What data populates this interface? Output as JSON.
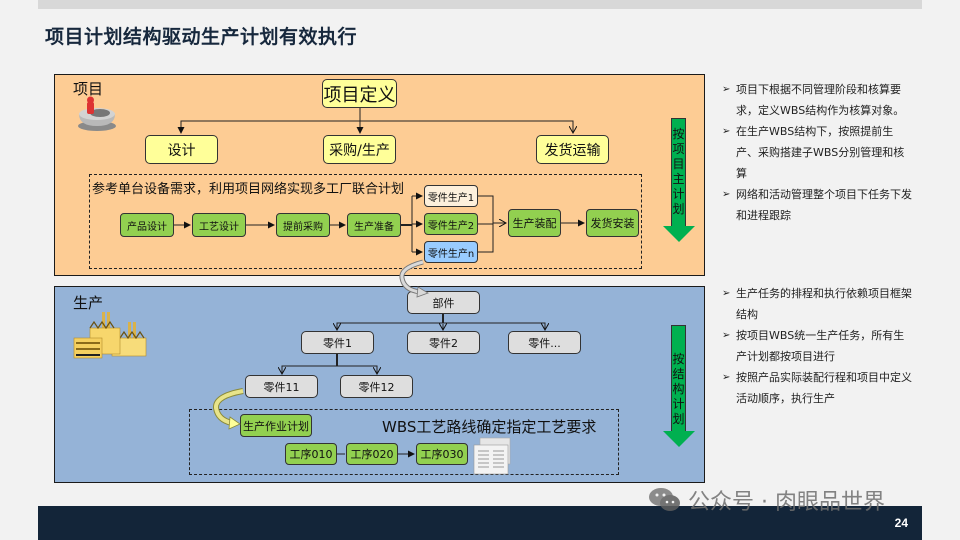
{
  "title": "项目计划结构驱动生产计划有效执行",
  "project_panel": {
    "label": "项目",
    "icon": "project-person-icon",
    "root": "项目定义",
    "branches": [
      "设计",
      "采购/生产",
      "发货运输"
    ],
    "network_title": "参考单台设备需求，利用项目网络实现多工厂联合计划",
    "network_steps": [
      "产品设计",
      "工艺设计",
      "提前采购",
      "生产准备"
    ],
    "parallel_parts": [
      "零件生产1",
      "零件生产2",
      "零件生产n"
    ],
    "assembly": "生产装配",
    "delivery": "发货安装",
    "side_arrow": [
      "按",
      "项",
      "目",
      "主",
      "计",
      "划"
    ]
  },
  "production_panel": {
    "label": "生产",
    "icon": "factory-icon",
    "root": "部件",
    "level1": [
      "零件1",
      "零件2",
      "零件..."
    ],
    "level2": [
      "零件11",
      "零件12"
    ],
    "work_plan": "生产作业计划",
    "wbs_title": "WBS工艺路线确定指定工艺要求",
    "operations": [
      "工序010",
      "工序020",
      "工序030"
    ],
    "side_arrow": [
      "按",
      "结",
      "构",
      "计",
      "划"
    ]
  },
  "bullets_top": [
    {
      "marker": "➢",
      "text": "项目下根据不同管理阶段和核算要求，定义WBS结构作为核算对象。"
    },
    {
      "marker": "➢",
      "text": "在生产WBS结构下，按照提前生产、采购搭建子WBS分别管理和核算"
    },
    {
      "marker": "➢",
      "text": "网络和活动管理整个项目下任务下发和进程跟踪"
    }
  ],
  "bullets_bottom": [
    {
      "marker": "➢",
      "text": "生产任务的排程和执行依赖项目框架结构"
    },
    {
      "marker": "➢",
      "text": "按项目WBS统一生产任务，所有生产计划都按项目进行"
    },
    {
      "marker": "➢",
      "text": "按照产品实际装配行程和项目中定义活动顺序，执行生产"
    }
  ],
  "watermark": "公众号 · 肉眼品世界",
  "page_number": "24",
  "colors": {
    "project_bg": "#fdcc94",
    "production_bg": "#95b3d7",
    "yellow_box": "#ffff99",
    "green_box": "#92d050",
    "arrow_green": "#00b050",
    "footer": "#132539"
  }
}
